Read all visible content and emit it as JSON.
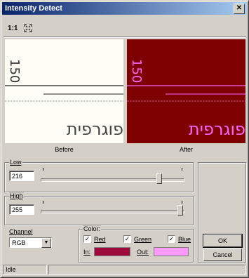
{
  "window": {
    "title": "Intensity Detect",
    "close_glyph": "✕"
  },
  "toolbar": {
    "zoom_label": "1:1",
    "fit_icon": "fit-to-window-icon"
  },
  "preview": {
    "before_caption": "Before",
    "after_caption": "After",
    "number_text": "150",
    "hebrew_text": "פוגרפית",
    "before_bg": "#fefdf6",
    "after_bg": "#7f0000",
    "after_ink": "#ff66ff"
  },
  "low": {
    "label": "Low",
    "value": "216",
    "slider_fraction": 0.847
  },
  "high": {
    "label": "High",
    "value": "255",
    "slider_fraction": 1.0
  },
  "channel": {
    "label": "Channel",
    "selected": "RGB"
  },
  "color": {
    "label": "Color:",
    "red_label": "Red",
    "red_checked": "✓",
    "green_label": "Green",
    "green_checked": "✓",
    "blue_label": "Blue",
    "blue_checked": "✓",
    "in_label": "In:",
    "out_label": "Out:",
    "in_color": "#9e0a3c",
    "out_color": "#ff99ff"
  },
  "buttons": {
    "ok": "OK",
    "cancel": "Cancel"
  },
  "status": {
    "text": "Idle"
  }
}
